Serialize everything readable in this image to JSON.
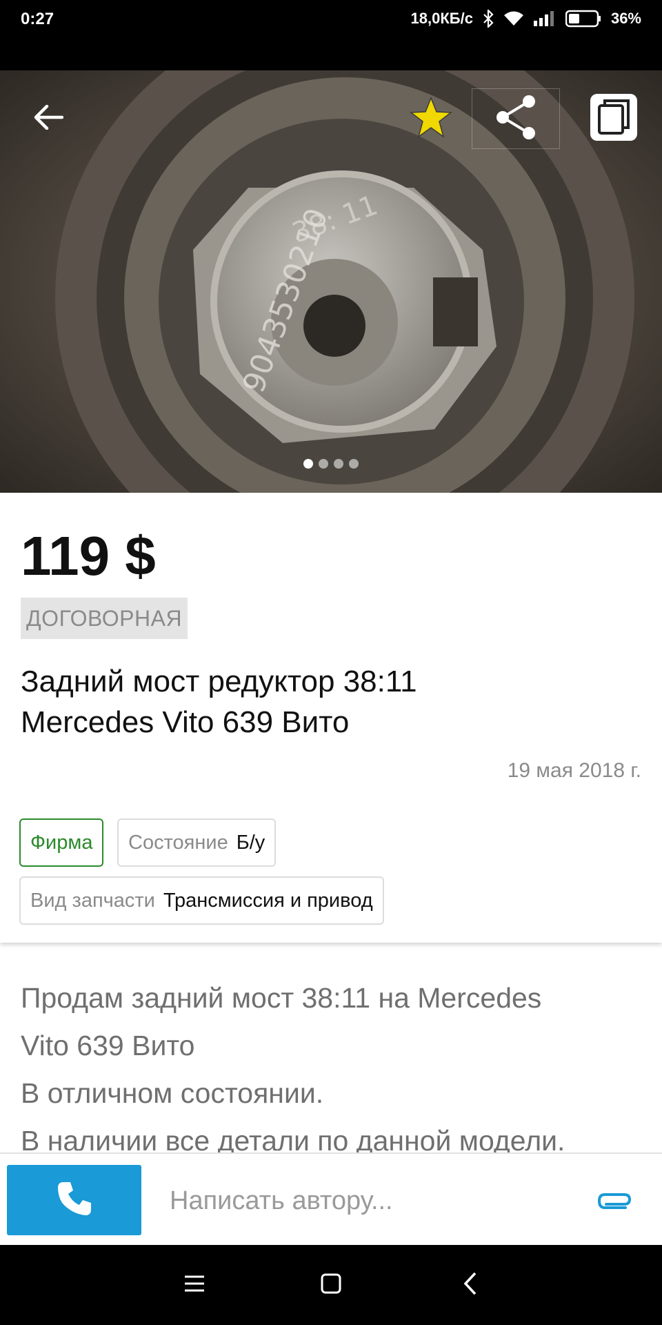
{
  "status": {
    "time": "0:27",
    "speed": "18,0КБ/с",
    "battery": "36%"
  },
  "toolbar": {
    "back_icon": "arrow-left-icon",
    "favorite_icon": "star-icon",
    "share_icon": "share-icon",
    "copy_icon": "copy-icon",
    "star_color": "#f0d800"
  },
  "gallery": {
    "image_count": 4,
    "active_index": 0
  },
  "listing": {
    "price": "119 $",
    "negotiable": "ДОГОВОРНАЯ",
    "title": "Задний мост редуктор 38:11 Mercedes Vito 639 Вито",
    "date": "19 мая 2018 г.",
    "seller_type": "Фирма",
    "condition_label": "Состояние",
    "condition_value": "Б/у",
    "part_type_label": "Вид запчасти",
    "part_type_value": "Трансмиссия и привод",
    "seller_color": "#2b8a2b"
  },
  "description": {
    "line1": "Продам задний мост 38:11 на Mercedes",
    "line2": "Vito 639 Вито",
    "line3": "В отличном состоянии.",
    "line4": "В наличии все детали по данной модели."
  },
  "contact": {
    "call_icon": "phone-icon",
    "message_placeholder": "Написать автору...",
    "attach_icon": "paperclip-icon",
    "call_color": "#1a9ad6"
  },
  "navigation": {
    "menu_icon": "menu-icon",
    "home_icon": "home-square-icon",
    "back_icon": "back-chevron-icon"
  }
}
